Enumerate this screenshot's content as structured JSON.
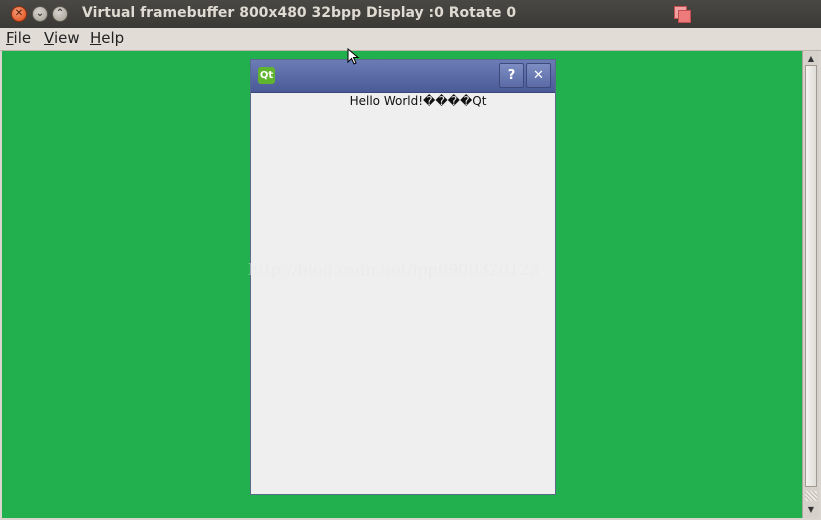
{
  "window": {
    "title": "Virtual framebuffer 800x480 32bpp Display :0 Rotate 0",
    "close_glyph": "✕",
    "minimize_glyph": "⌄",
    "maximize_glyph": "⌃"
  },
  "menubar": {
    "items": [
      {
        "mnemonic": "F",
        "rest": "ile"
      },
      {
        "mnemonic": "V",
        "rest": "iew"
      },
      {
        "mnemonic": "H",
        "rest": "elp"
      }
    ]
  },
  "framebuffer": {
    "background": "#22b04f"
  },
  "qt_dialog": {
    "logo_text": "Qt",
    "help_glyph": "?",
    "close_glyph": "✕",
    "label_text": "Hello World!����Qt"
  },
  "watermark": {
    "text": "http://blog.csdn.net/lpp0900320123"
  },
  "scrollbar": {
    "up_glyph": "▲",
    "down_glyph": "▼"
  }
}
